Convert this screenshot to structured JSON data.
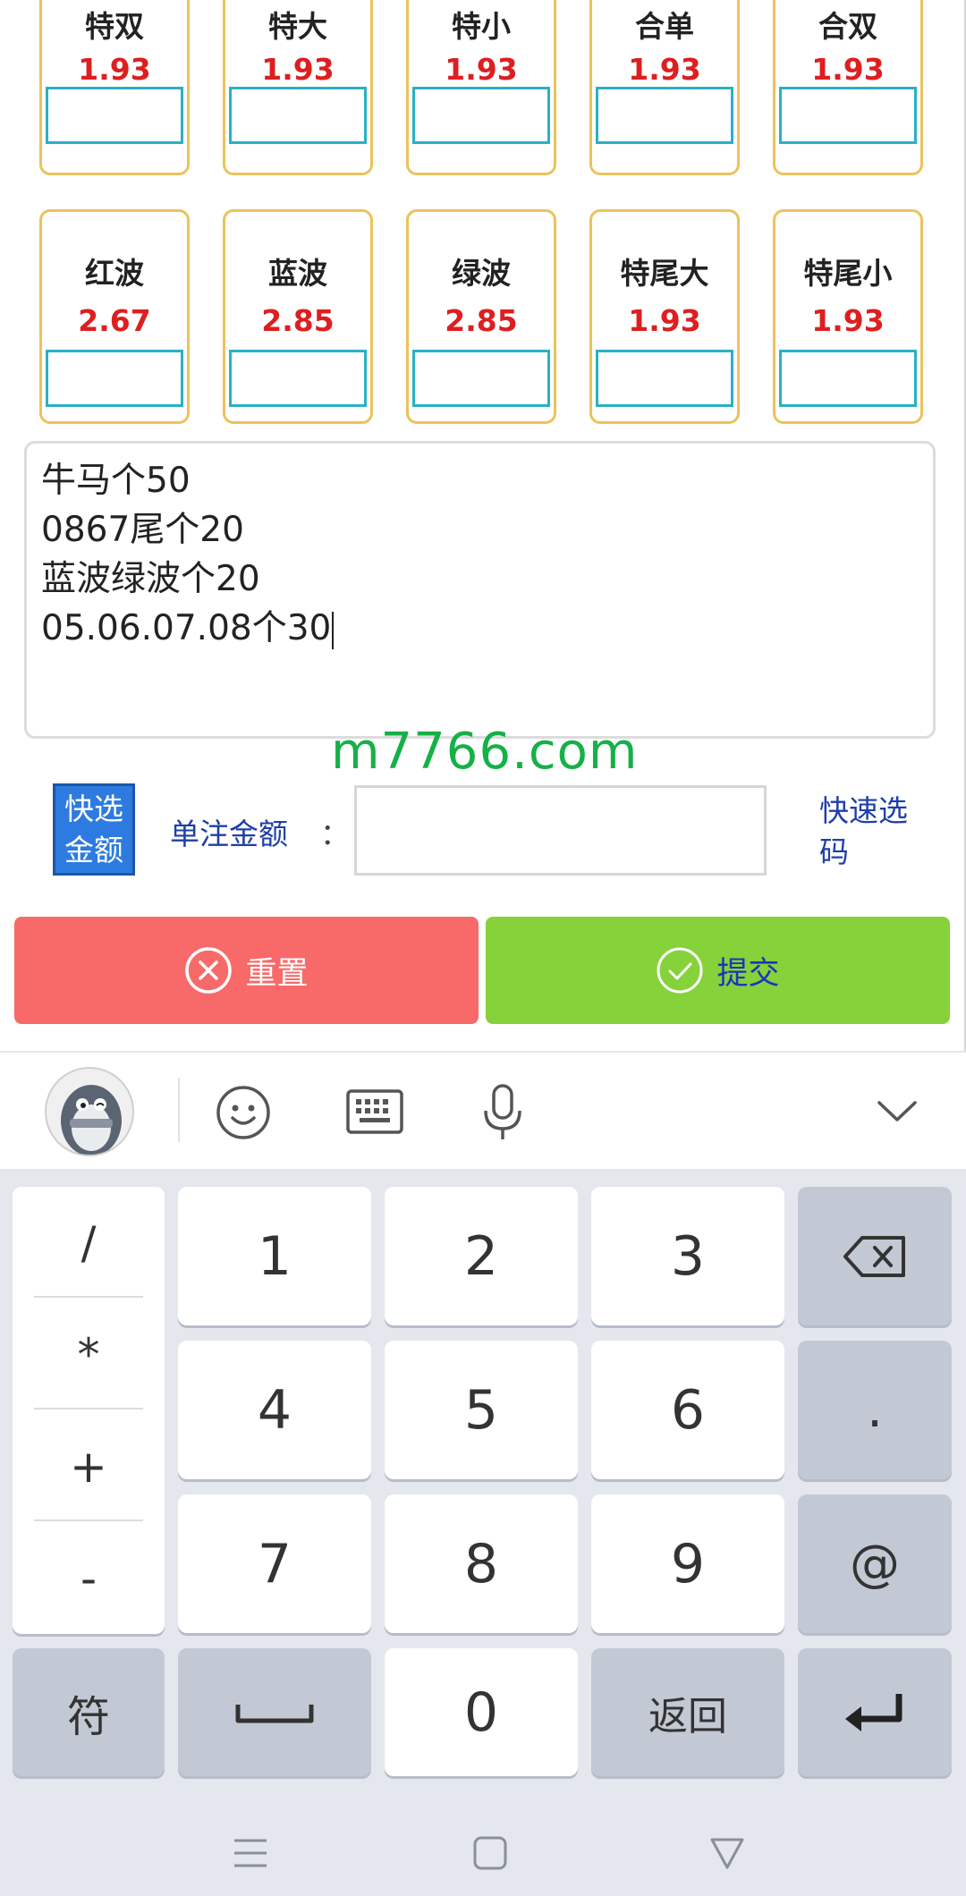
{
  "bet_cards_row1": [
    {
      "name": "特双",
      "odds": "1.93"
    },
    {
      "name": "特大",
      "odds": "1.93"
    },
    {
      "name": "特小",
      "odds": "1.93"
    },
    {
      "name": "合单",
      "odds": "1.93"
    },
    {
      "name": "合双",
      "odds": "1.93"
    }
  ],
  "bet_cards_row2": [
    {
      "name": "红波",
      "odds": "2.67"
    },
    {
      "name": "蓝波",
      "odds": "2.85"
    },
    {
      "name": "绿波",
      "odds": "2.85"
    },
    {
      "name": "特尾大",
      "odds": "1.93"
    },
    {
      "name": "特尾小",
      "odds": "1.93"
    }
  ],
  "bet_text": {
    "lines": [
      "牛马个50",
      "0867尾个20",
      "蓝波绿波个20",
      "05.06.07.08个30"
    ]
  },
  "watermark": "m7766.com",
  "amount_row": {
    "quick_amount_line1": "快选",
    "quick_amount_line2": "金额",
    "single_label": "单注金额",
    "colon": "：",
    "amount_value": "",
    "quick_pick_line1": "快速选",
    "quick_pick_line2": "码"
  },
  "buttons": {
    "reset": "重置",
    "submit": "提交"
  },
  "keyboard": {
    "symbols": [
      "/",
      "*",
      "+",
      "-"
    ],
    "digits": [
      "1",
      "2",
      "3",
      "4",
      "5",
      "6",
      "7",
      "8",
      "9",
      "0"
    ],
    "dot": ".",
    "at": "@",
    "fu": "符",
    "back": "返回"
  },
  "colors": {
    "card_border": "#ecc25c",
    "odds": "#dd1f1f",
    "input_border": "#2ab0c6",
    "reset_bg": "#f76a69",
    "submit_bg": "#86d23a",
    "watermark": "#16b048",
    "link_blue": "#1f3fa8"
  }
}
